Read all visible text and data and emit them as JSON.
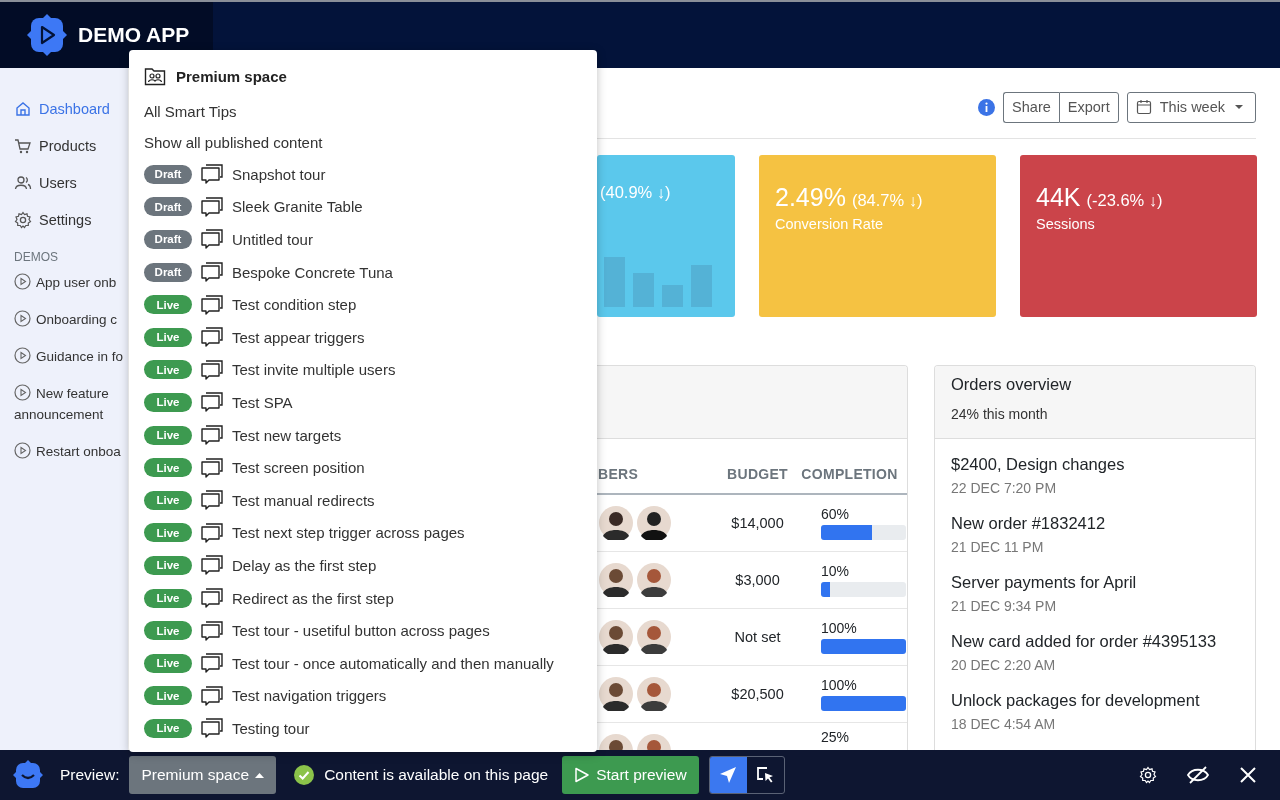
{
  "header": {
    "app_name": "DEMO APP"
  },
  "sidebar": {
    "items": [
      {
        "label": "Dashboard",
        "selected": true
      },
      {
        "label": "Products",
        "selected": false
      },
      {
        "label": "Users",
        "selected": false
      },
      {
        "label": "Settings",
        "selected": false
      }
    ],
    "section_title": "DEMOS",
    "demos": [
      "App user onb",
      "Onboarding c",
      "Guidance in fo",
      "New feature announcement",
      "Restart onboa"
    ]
  },
  "toolbar": {
    "share": "Share",
    "export": "Export",
    "date_range": "This week"
  },
  "stats": [
    {
      "change": "(40.9% ↓)",
      "color": "#5bc8ec",
      "kind": "bars"
    },
    {
      "value": "2.49%",
      "change": "(84.7% ↓)",
      "label": "Conversion Rate",
      "color": "#f5c242",
      "kind": "plain"
    },
    {
      "value": "44K",
      "change": "(-23.6% ↓)",
      "label": "Sessions",
      "color": "#cb444a",
      "kind": "plain"
    }
  ],
  "projects_table": {
    "columns": [
      "BERS",
      "BUDGET",
      "COMPLETION"
    ],
    "rows": [
      {
        "budget": "$14,000",
        "completion": "60%",
        "level": 0.6
      },
      {
        "budget": "$3,000",
        "completion": "10%",
        "level": 0.1
      },
      {
        "budget": "Not set",
        "completion": "100%",
        "level": 1
      },
      {
        "budget": "$20,500",
        "completion": "100%",
        "level": 1
      },
      {
        "completion": "25%"
      }
    ]
  },
  "orders": {
    "title": "Orders overview",
    "subtitle": "24% this month",
    "items": [
      {
        "title": "$2400, Design changes",
        "time": "22 DEC 7:20 PM"
      },
      {
        "title": "New order #1832412",
        "time": "21 DEC 11 PM"
      },
      {
        "title": "Server payments for April",
        "time": "21 DEC 9:34 PM"
      },
      {
        "title": "New card added for order #4395133",
        "time": "20 DEC 2:20 AM"
      },
      {
        "title": "Unlock packages for development",
        "time": "18 DEC 4:54 AM"
      }
    ]
  },
  "dropdown": {
    "title": "Premium space",
    "options": [
      "All Smart Tips",
      "Show all published content"
    ],
    "items": [
      {
        "status": "Draft",
        "kind": "draft",
        "label": "Snapshot tour"
      },
      {
        "status": "Draft",
        "kind": "draft",
        "label": "Sleek Granite Table"
      },
      {
        "status": "Draft",
        "kind": "draft",
        "label": "Untitled tour"
      },
      {
        "status": "Draft",
        "kind": "draft",
        "label": "Bespoke Concrete Tuna"
      },
      {
        "status": "Live",
        "kind": "live",
        "label": "Test condition step"
      },
      {
        "status": "Live",
        "kind": "live",
        "label": "Test appear triggers"
      },
      {
        "status": "Live",
        "kind": "live",
        "label": "Test invite multiple users"
      },
      {
        "status": "Live",
        "kind": "live",
        "label": "Test SPA"
      },
      {
        "status": "Live",
        "kind": "live",
        "label": "Test new targets"
      },
      {
        "status": "Live",
        "kind": "live",
        "label": "Test screen position"
      },
      {
        "status": "Live",
        "kind": "live",
        "label": "Test manual redirects"
      },
      {
        "status": "Live",
        "kind": "live",
        "label": "Test next step trigger across pages"
      },
      {
        "status": "Live",
        "kind": "live",
        "label": "Delay as the first step"
      },
      {
        "status": "Live",
        "kind": "live",
        "label": "Redirect as the first step"
      },
      {
        "status": "Live",
        "kind": "live",
        "label": "Test tour - usetiful button across pages"
      },
      {
        "status": "Live",
        "kind": "live",
        "label": "Test tour - once automatically and then manually"
      },
      {
        "status": "Live",
        "kind": "live",
        "label": "Test navigation triggers"
      },
      {
        "status": "Live",
        "kind": "live",
        "label": "Testing tour"
      }
    ]
  },
  "preview_bar": {
    "label": "Preview:",
    "space_button": "Premium space",
    "status": "Content is available on this page",
    "start_button": "Start preview",
    "modes": [
      {
        "selected": true
      },
      {
        "selected": false
      }
    ]
  }
}
